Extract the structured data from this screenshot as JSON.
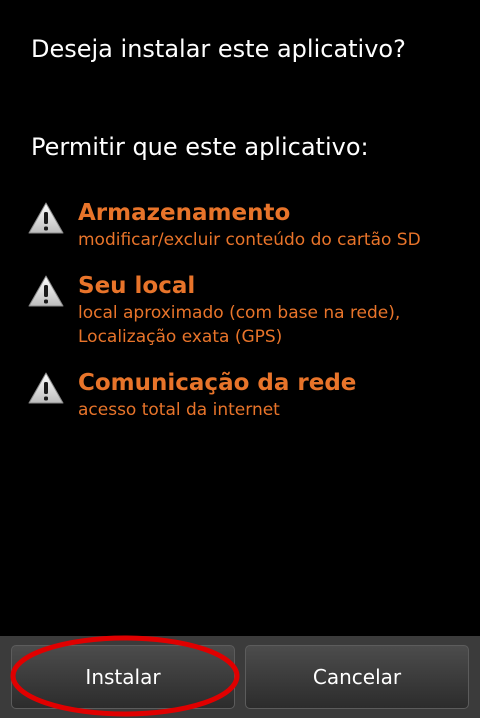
{
  "dialog": {
    "question": "Deseja instalar este aplicativo?",
    "permit_heading": "Permitir que este aplicativo:"
  },
  "permissions": [
    {
      "icon": "warning-icon",
      "title": "Armazenamento",
      "description": [
        "modificar/excluir conteúdo do cartão SD"
      ]
    },
    {
      "icon": "warning-icon",
      "title": "Seu local",
      "description": [
        "local aproximado (com base na rede),",
        "Localização exata (GPS)"
      ]
    },
    {
      "icon": "warning-icon",
      "title": "Comunicação da rede",
      "description": [
        "acesso total da internet"
      ]
    }
  ],
  "buttons": {
    "install_label": "Instalar",
    "cancel_label": "Cancelar"
  },
  "colors": {
    "background": "#000000",
    "permission_text": "#e8742a",
    "highlight_annotation": "#e00000"
  }
}
